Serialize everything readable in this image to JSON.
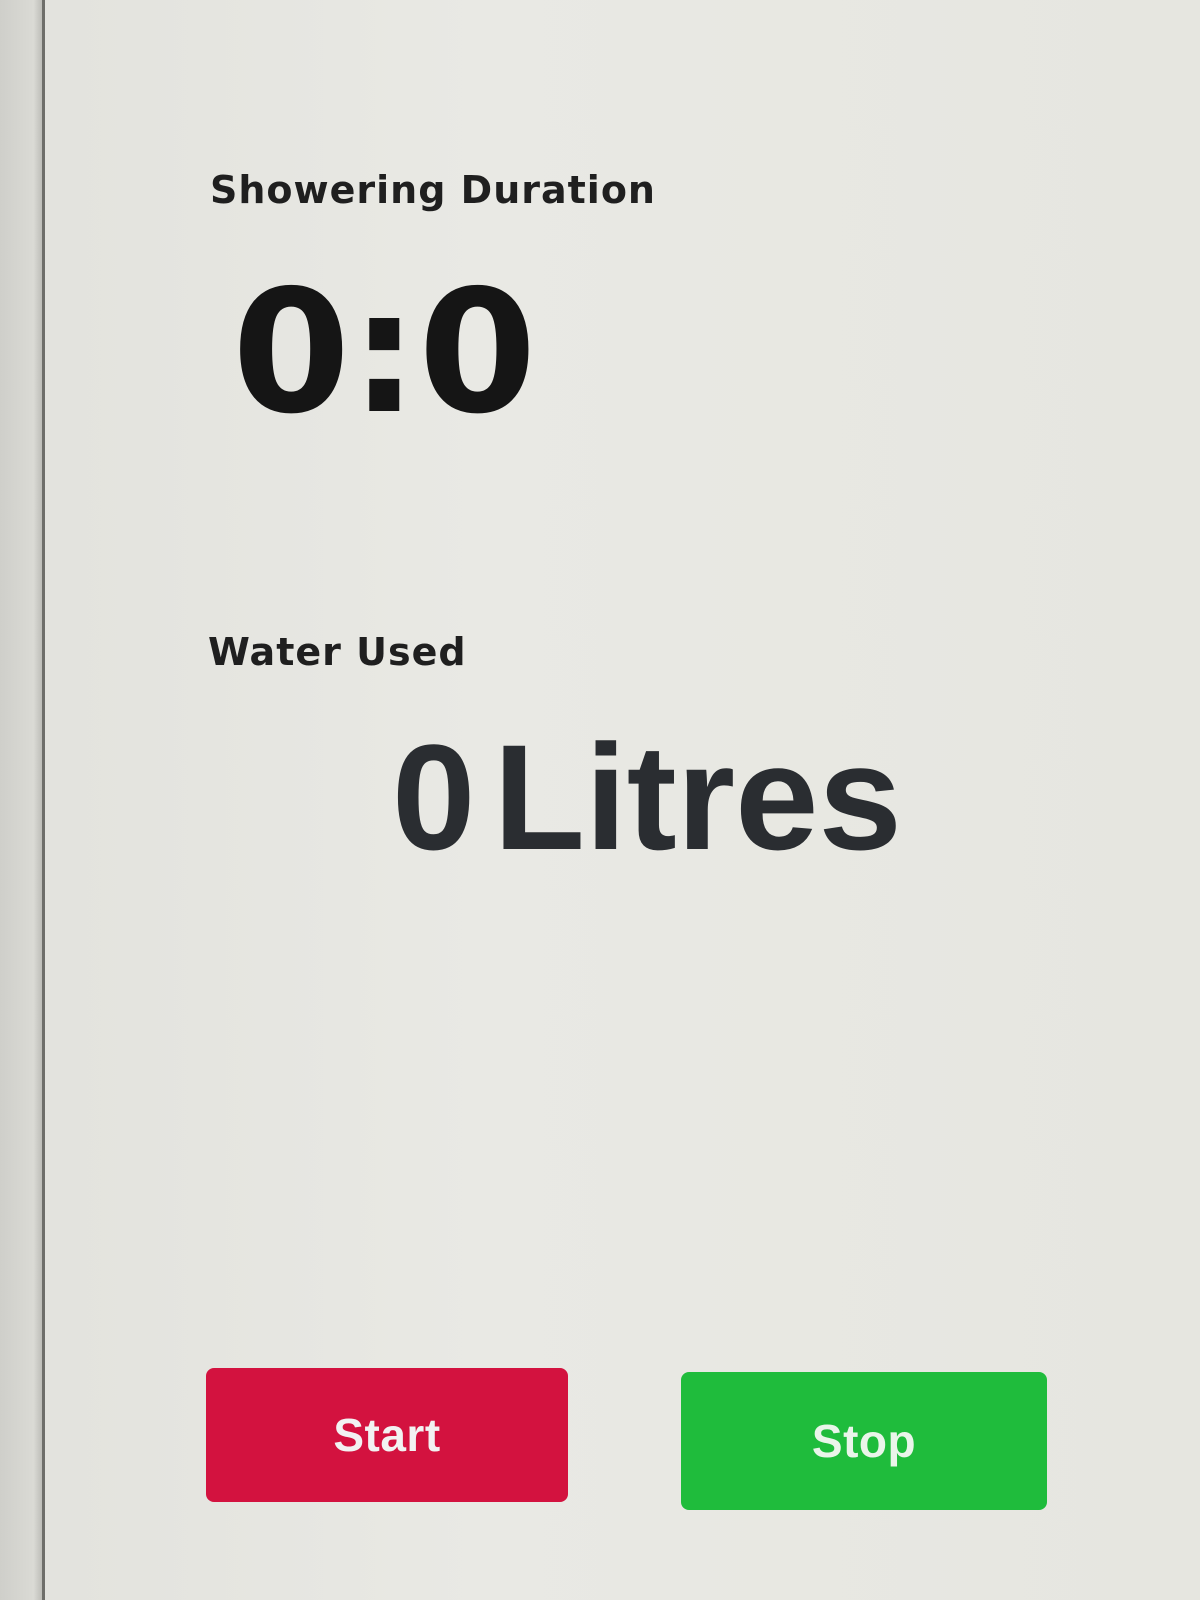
{
  "duration": {
    "label": "Showering Duration",
    "value": "0:0"
  },
  "water": {
    "label": "Water Used",
    "amount": "0",
    "unit": "Litres"
  },
  "controls": {
    "start_label": "Start",
    "stop_label": "Stop"
  },
  "colors": {
    "start_button": "#d3123f",
    "stop_button": "#1fbc3c",
    "background": "#e6e6e1"
  }
}
